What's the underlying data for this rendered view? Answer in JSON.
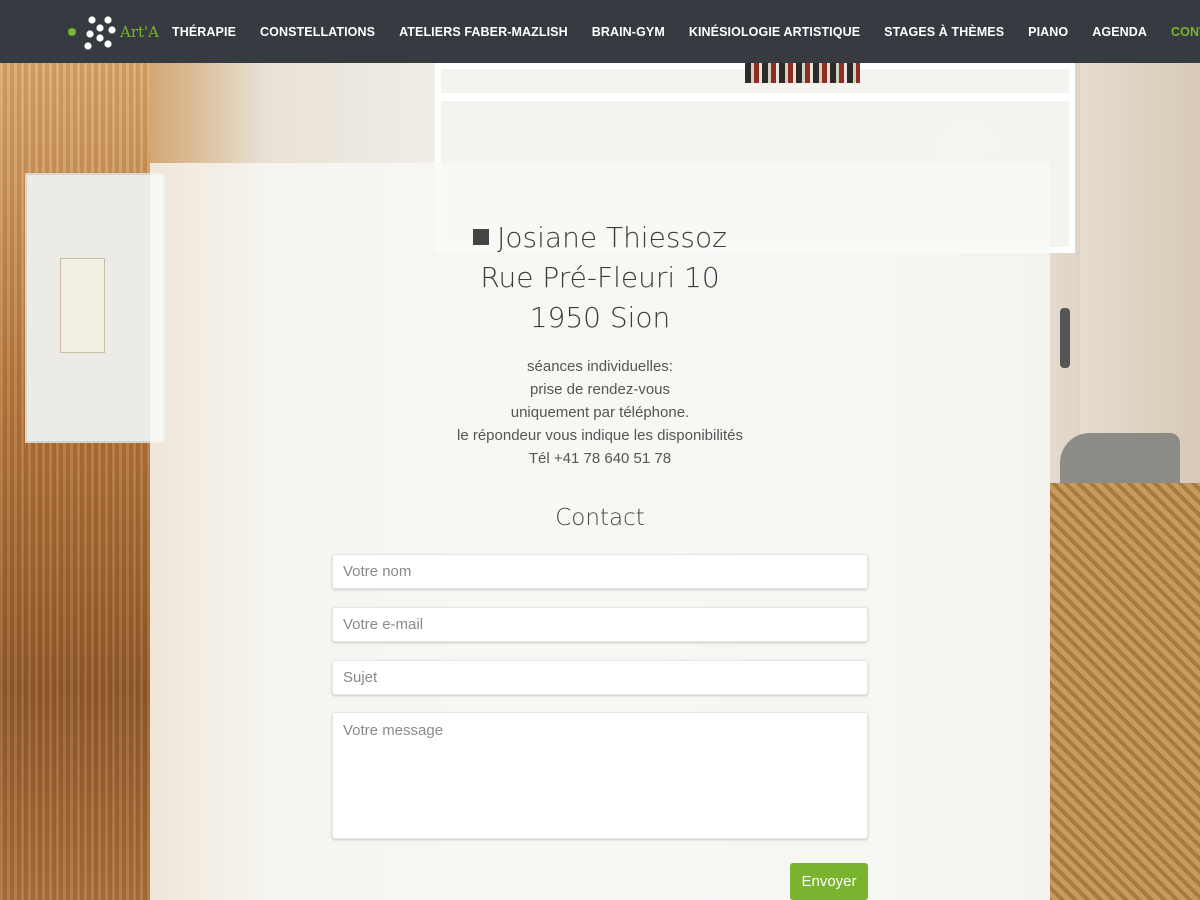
{
  "logo": {
    "text": "Art'A"
  },
  "nav": [
    {
      "label": "THÉRAPIE",
      "active": false
    },
    {
      "label": "CONSTELLATIONS",
      "active": false
    },
    {
      "label": "ATELIERS FABER-MAZLISH",
      "active": false
    },
    {
      "label": "BRAIN-GYM",
      "active": false
    },
    {
      "label": "KINÉSIOLOGIE ARTISTIQUE",
      "active": false
    },
    {
      "label": "STAGES À THÈMES",
      "active": false
    },
    {
      "label": "PIANO",
      "active": false
    },
    {
      "label": "AGENDA",
      "active": false
    },
    {
      "label": "CONTACT",
      "active": true
    }
  ],
  "address": {
    "name": "Josiane Thiessoz",
    "street": "Rue Pré-Fleuri 10",
    "city": "1950 Sion"
  },
  "info": {
    "line1": "séances individuelles:",
    "line2": "prise de rendez-vous",
    "line3": "uniquement par téléphone.",
    "line4": "le répondeur vous indique les disponibilités",
    "phone": "Tél +41 78 640 51 78"
  },
  "contact": {
    "title": "Contact",
    "name_placeholder": "Votre nom",
    "email_placeholder": "Votre e-mail",
    "subject_placeholder": "Sujet",
    "message_placeholder": "Votre message",
    "send_label": "Envoyer"
  },
  "colors": {
    "accent": "#7ab32e",
    "header_bg": "#363b41"
  }
}
